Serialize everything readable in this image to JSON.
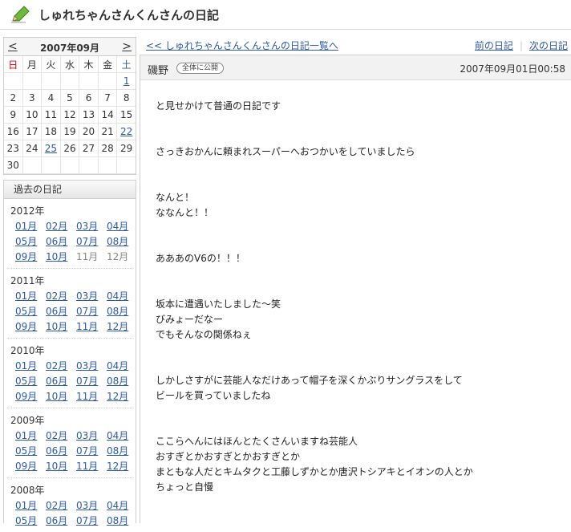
{
  "header": {
    "title": "しゅれちゃんさんくんさんの日記"
  },
  "calendar": {
    "prev": "<",
    "next": ">",
    "month": "2007年09月",
    "dow": [
      "日",
      "月",
      "火",
      "水",
      "木",
      "金",
      "土"
    ],
    "weeks": [
      [
        "",
        "",
        "",
        "",
        "",
        "",
        "1"
      ],
      [
        "2",
        "3",
        "4",
        "5",
        "6",
        "7",
        "8"
      ],
      [
        "9",
        "10",
        "11",
        "12",
        "13",
        "14",
        "15"
      ],
      [
        "16",
        "17",
        "18",
        "19",
        "20",
        "21",
        "22"
      ],
      [
        "23",
        "24",
        "25",
        "26",
        "27",
        "28",
        "29"
      ],
      [
        "30",
        "",
        "",
        "",
        "",
        "",
        ""
      ]
    ]
  },
  "archive": {
    "title": "過去の日記",
    "years": [
      {
        "year": "2012年",
        "months": [
          "01月",
          "02月",
          "03月",
          "04月",
          "05月",
          "06月",
          "07月",
          "08月",
          "09月",
          "10月",
          "11月",
          "12月"
        ]
      },
      {
        "year": "2011年",
        "months": [
          "01月",
          "02月",
          "03月",
          "04月",
          "05月",
          "06月",
          "07月",
          "08月",
          "09月",
          "10月",
          "11月",
          "12月"
        ]
      },
      {
        "year": "2010年",
        "months": [
          "01月",
          "02月",
          "03月",
          "04月",
          "05月",
          "06月",
          "07月",
          "08月",
          "09月",
          "10月",
          "11月",
          "12月"
        ]
      },
      {
        "year": "2009年",
        "months": [
          "01月",
          "02月",
          "03月",
          "04月",
          "05月",
          "06月",
          "07月",
          "08月",
          "09月",
          "10月",
          "11月",
          "12月"
        ]
      },
      {
        "year": "2008年",
        "months": [
          "01月",
          "02月",
          "03月",
          "04月",
          "05月",
          "06月",
          "07月",
          "08月"
        ]
      }
    ]
  },
  "nav": {
    "back": "<< しゅれちゃんさんくんさんの日記一覧へ",
    "prev": "前の日記",
    "next": "次の日記"
  },
  "entry": {
    "author": "磯野",
    "badge": "全体に公開",
    "date": "2007年09月01日00:58",
    "paragraphs": [
      [
        "と見せかけて普通の日記です"
      ],
      [
        "さっきおかんに頼まれスーパーへおつかいをしていましたら"
      ],
      [
        "なんと！",
        "ななんと！！"
      ],
      [
        "あああのV6の！！！"
      ],
      [
        "坂本に遭遇いたしました～笑",
        "びみょーだなー",
        "でもそんなの関係ねぇ"
      ],
      [
        "しかしさすがに芸能人なだけあって帽子を深くかぶりサングラスをして",
        "ビールを買っていましたね"
      ],
      [
        "ここらへんにはほんとたくさんいますね芸能人",
        "おすぎとかおすぎとかおすぎとか",
        "まともな人だとキムタクと工藤しずかとか唐沢トシアキとイオンの人とか",
        "ちょっと自慢"
      ]
    ]
  }
}
